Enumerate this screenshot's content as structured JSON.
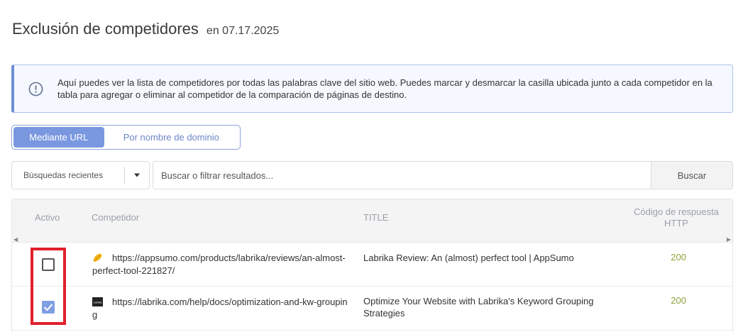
{
  "header": {
    "title": "Exclusión de competidores",
    "date": "en 07.17.2025"
  },
  "info": {
    "text": "Aquí puedes ver la lista de competidores por todas las palabras clave del sitio web. Puedes marcar y desmarcar la casilla ubicada junto a cada competidor en la tabla para agregar o eliminar al competidor de la comparación de páginas de destino."
  },
  "toggle": {
    "by_url": "Mediante URL",
    "by_domain": "Por nombre de dominio"
  },
  "search": {
    "recent_label": "Búsquedas recientes",
    "placeholder": "Buscar o filtrar resultados...",
    "button": "Buscar"
  },
  "table": {
    "headers": {
      "active": "Activo",
      "competitor": "Competidor",
      "title": "TITLE",
      "http": "Código de respuesta HTTP"
    },
    "rows": [
      {
        "checked": false,
        "url": "https://appsumo.com/products/labrika/reviews/an-almost-perfect-tool-221827/",
        "title": "Labrika Review: An (almost) perfect tool | AppSumo",
        "code": "200"
      },
      {
        "checked": true,
        "url": "https://labrika.com/help/docs/optimization-and-kw-grouping",
        "title": "Optimize Your Website with Labrika's Keyword Grouping Strategies",
        "code": "200",
        "favicon_text": "Labrika"
      }
    ]
  },
  "colors": {
    "accent": "#7a98e0",
    "info_border": "#6d8fd4",
    "code_green": "#8ca33a",
    "highlight_red": "#e0202c"
  }
}
